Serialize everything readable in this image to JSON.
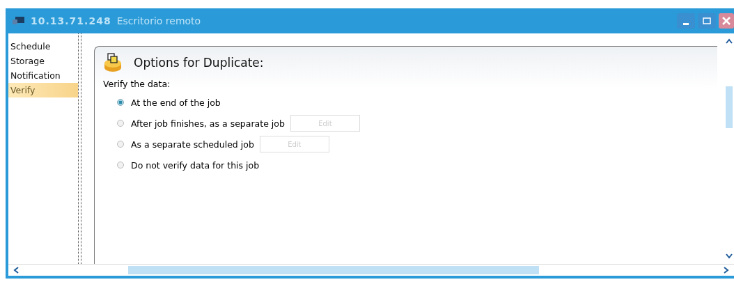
{
  "window": {
    "title_host": "10.13.71.248",
    "title_app": "Escritorio remoto"
  },
  "sidebar": {
    "items": [
      {
        "label": "Schedule",
        "selected": false
      },
      {
        "label": "Storage",
        "selected": false
      },
      {
        "label": "Notification",
        "selected": false
      },
      {
        "label": "Verify",
        "selected": true
      }
    ]
  },
  "panel": {
    "title": "Options for Duplicate:",
    "group_label": "Verify the data:",
    "options": [
      {
        "label": "At the end of the job",
        "selected": true
      },
      {
        "label": "After job finishes, as a separate job",
        "selected": false,
        "button": {
          "label": "Edit",
          "disabled": true
        }
      },
      {
        "label": "As a separate scheduled job",
        "selected": false,
        "button": {
          "label": "Edit",
          "disabled": true
        }
      },
      {
        "label": "Do not verify data for this job",
        "selected": false
      }
    ]
  }
}
